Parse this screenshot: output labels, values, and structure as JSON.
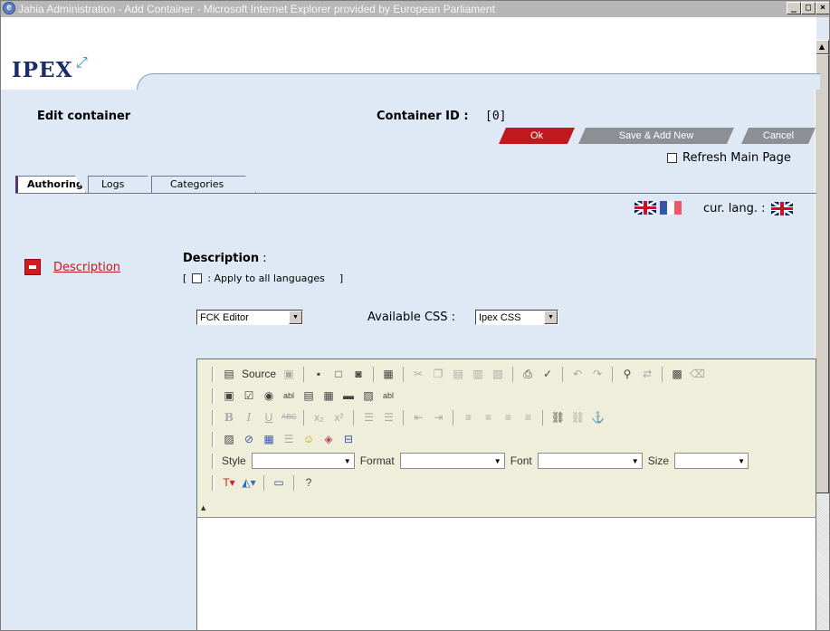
{
  "window": {
    "title": "Jahia Administration - Add Container - Microsoft Internet Explorer provided by European Parliament",
    "btn_min": "_",
    "btn_max": "□",
    "btn_close": "×"
  },
  "header": {
    "logo": "IPEX",
    "edit_title": "Edit container",
    "container_id_label": "Container ID :",
    "container_id_value": "[0]"
  },
  "actions": {
    "ok": "Ok",
    "save_add_new": "Save & Add New",
    "cancel": "Cancel",
    "refresh_main_page": "Refresh Main Page"
  },
  "tabs": [
    {
      "label": "Authoring",
      "active": true
    },
    {
      "label": "Logs",
      "active": false
    },
    {
      "label": "Categories",
      "active": false
    }
  ],
  "languages": {
    "cur_lang_label": "cur. lang. :"
  },
  "sidebar": {
    "item_label": "Description"
  },
  "field": {
    "title": "Description",
    "colon": " :",
    "apply_open": "[",
    "apply_text": ": Apply to all languages",
    "apply_close": "]",
    "editor_select_value": "FCK Editor",
    "available_css_label": "Available CSS :",
    "css_select_value": "Ipex CSS"
  },
  "toolbar": {
    "source_label": "Source",
    "style_label": "Style",
    "format_label": "Format",
    "font_label": "Font",
    "size_label": "Size",
    "spellcheck_abbr": "ABC",
    "field_abbr": "abl"
  }
}
